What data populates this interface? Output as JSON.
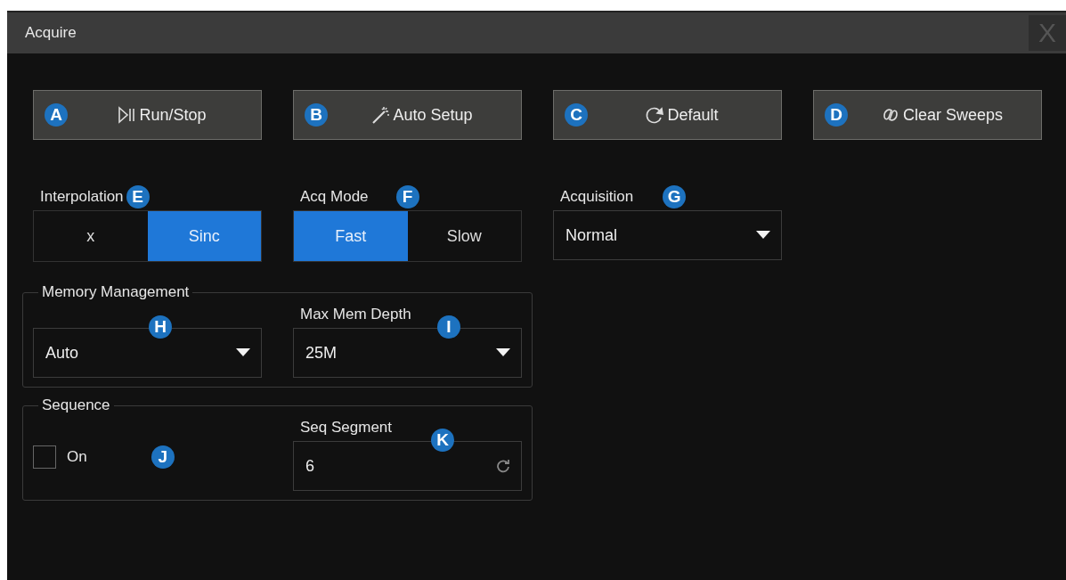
{
  "window": {
    "title": "Acquire",
    "close": "X"
  },
  "buttons": [
    {
      "kind": "run-stop",
      "label": "Run/Stop",
      "marker": "A"
    },
    {
      "kind": "auto-setup",
      "label": "Auto Setup",
      "marker": "B"
    },
    {
      "kind": "default",
      "label": "Default",
      "marker": "C"
    },
    {
      "kind": "clear-sweeps",
      "label": "Clear Sweeps",
      "marker": "D"
    }
  ],
  "interpolation": {
    "label": "Interpolation",
    "marker": "E",
    "options": [
      {
        "label": "x",
        "selected": false
      },
      {
        "label": "Sinc",
        "selected": true
      }
    ]
  },
  "acq_mode": {
    "label": "Acq Mode",
    "marker": "F",
    "options": [
      {
        "label": "Fast",
        "selected": true
      },
      {
        "label": "Slow",
        "selected": false
      }
    ]
  },
  "acquisition": {
    "label": "Acquisition",
    "marker": "G",
    "value": "Normal"
  },
  "memory_management": {
    "title": "Memory Management",
    "mode": {
      "value": "Auto",
      "marker": "H"
    },
    "max_mem_depth": {
      "label": "Max Mem Depth",
      "value": "25M",
      "marker": "I"
    }
  },
  "sequence": {
    "title": "Sequence",
    "on": {
      "label": "On",
      "checked": false,
      "marker": "J"
    },
    "seq_segment": {
      "label": "Seq Segment",
      "value": "6",
      "marker": "K"
    }
  }
}
